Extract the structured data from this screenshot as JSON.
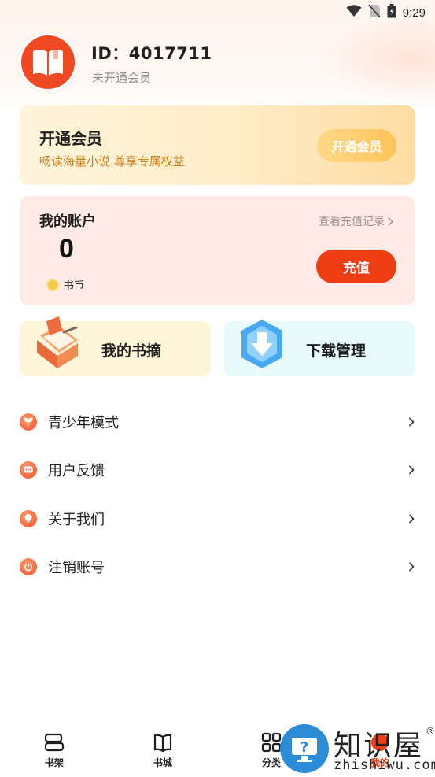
{
  "status_bar": {
    "time": "9:29"
  },
  "profile": {
    "id_text": "ID：4017711",
    "member_status": "未开通会员"
  },
  "vip_card": {
    "title": "开通会员",
    "subtitle": "畅读海量小说 尊享专属权益",
    "button": "开通会员"
  },
  "account": {
    "title": "我的账户",
    "balance": "0",
    "currency": "书币",
    "history_link": "查看充值记录",
    "recharge_button": "充值"
  },
  "tiles": {
    "excerpt": "我的书摘",
    "download": "下载管理"
  },
  "menu": [
    {
      "label": "青少年模式",
      "icon": "sprout-icon"
    },
    {
      "label": "用户反馈",
      "icon": "chat-icon"
    },
    {
      "label": "关于我们",
      "icon": "location-icon"
    },
    {
      "label": "注销账号",
      "icon": "power-icon"
    }
  ],
  "bottom_nav": [
    {
      "label": "书架",
      "icon": "bookshelf-icon"
    },
    {
      "label": "书城",
      "icon": "book-open-icon"
    },
    {
      "label": "分类",
      "icon": "grid-icon"
    },
    {
      "label": "我的",
      "icon": "profile-icon",
      "active": true
    }
  ],
  "watermark": {
    "title": "知识屋",
    "url": "zhishiwu.com",
    "mark": "®"
  },
  "colors": {
    "accent": "#ef3d14",
    "vip_text": "#c8811d",
    "account_bg": "#ffeae5"
  }
}
